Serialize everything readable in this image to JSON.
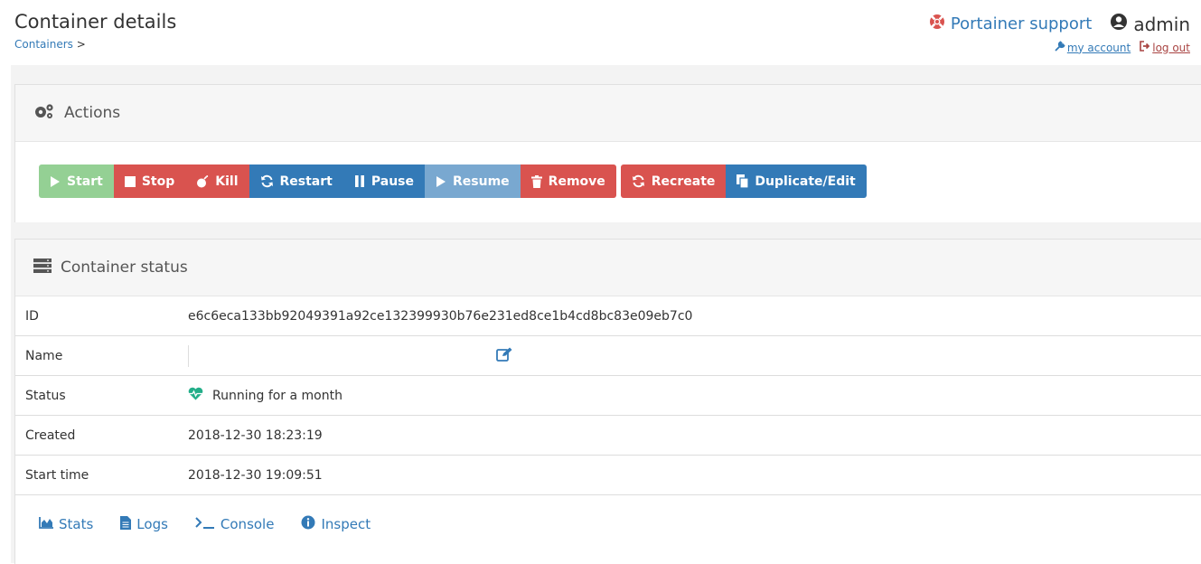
{
  "header": {
    "title": "Container details",
    "breadcrumb_link": "Containers",
    "breadcrumb_sep": ">",
    "support_label": "Portainer support",
    "user_name": "admin",
    "my_account_label": "my account",
    "log_out_label": "log out"
  },
  "actions": {
    "title": "Actions",
    "buttons": {
      "start": "Start",
      "stop": "Stop",
      "kill": "Kill",
      "restart": "Restart",
      "pause": "Pause",
      "resume": "Resume",
      "remove": "Remove",
      "recreate": "Recreate",
      "duplicate": "Duplicate/Edit"
    }
  },
  "status": {
    "title": "Container status",
    "rows": {
      "id": {
        "label": "ID",
        "value": "e6c6eca133bb92049391a92ce132399930b76e231ed8ce1b4cd8bc83e09eb7c0"
      },
      "name": {
        "label": "Name",
        "value": ""
      },
      "status": {
        "label": "Status",
        "value": "Running for a month"
      },
      "created": {
        "label": "Created",
        "value": "2018-12-30 18:23:19"
      },
      "start_time": {
        "label": "Start time",
        "value": "2018-12-30 19:09:51"
      }
    },
    "links": {
      "stats": "Stats",
      "logs": "Logs",
      "console": "Console",
      "inspect": "Inspect"
    }
  },
  "colors": {
    "success": "#5cb85c",
    "danger": "#d9534f",
    "primary": "#337ab7",
    "running": "#23ae89"
  }
}
